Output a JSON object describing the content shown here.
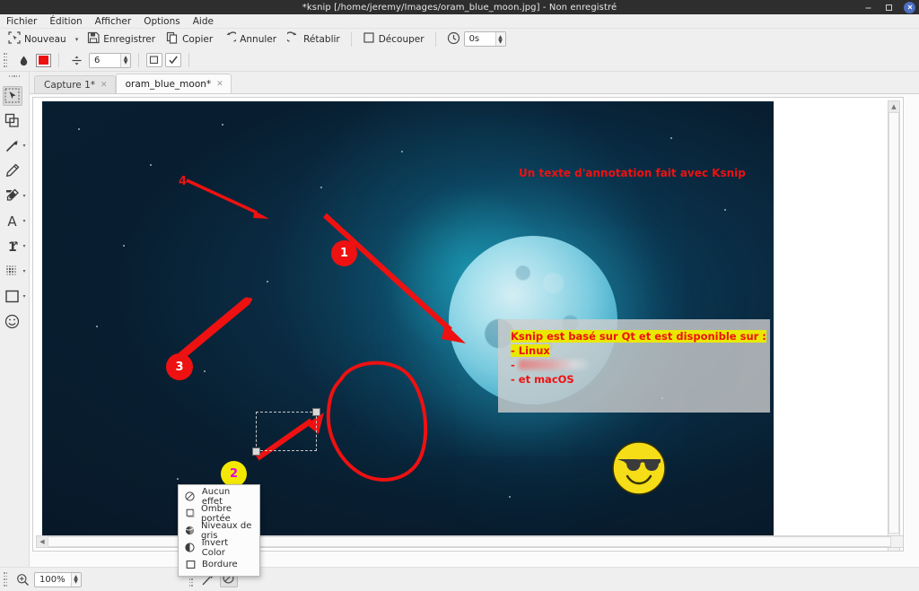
{
  "window": {
    "title": "*ksnip [/home/jeremy/Images/oram_blue_moon.jpg] - Non enregistré",
    "minimize_label": "—",
    "maximize_label": "❐",
    "close_label": "✕"
  },
  "menubar": {
    "items": [
      {
        "label": "Fichier",
        "accel": "F"
      },
      {
        "label": "Édition",
        "accel": "d"
      },
      {
        "label": "Afficher",
        "accel": "A"
      },
      {
        "label": "Options",
        "accel": "O"
      },
      {
        "label": "Aide",
        "accel": "A"
      }
    ]
  },
  "toolbar": {
    "new_label": "Nouveau",
    "new_icon": "new-capture-icon",
    "save_label": "Enregistrer",
    "save_icon": "floppy-disk-icon",
    "copy_label": "Copier",
    "copy_icon": "copy-icon",
    "undo_label": "Annuler",
    "undo_icon": "undo-arrow-icon",
    "redo_label": "Rétablir",
    "redo_icon": "redo-arrow-icon",
    "crop_label": "Découper",
    "crop_icon": "crop-square-icon",
    "delay_icon": "clock-icon",
    "delay_value": "0s"
  },
  "toolbar_props": {
    "opacity_icon": "water-drop-icon",
    "color_label": "",
    "color_hex": "#ee1111",
    "width_icon": "line-width-icon",
    "width_value": "6",
    "fill_icon": "fill-square-icon",
    "check_icon": "checkbox-checked-icon"
  },
  "tools": [
    {
      "name": "select-tool",
      "icon": "select-rectangle-icon",
      "active": true,
      "has_menu": false
    },
    {
      "name": "duplicate-tool",
      "icon": "duplicate-squares-icon",
      "active": false,
      "has_menu": false
    },
    {
      "name": "arrow-tool",
      "icon": "arrow-icon",
      "active": false,
      "has_menu": true
    },
    {
      "name": "pen-tool",
      "icon": "pencil-icon",
      "active": false,
      "has_menu": false
    },
    {
      "name": "marker-tool",
      "icon": "marker-pen-icon",
      "active": false,
      "has_menu": true
    },
    {
      "name": "text-tool",
      "icon": "text-a-icon",
      "active": false,
      "has_menu": true
    },
    {
      "name": "number-tool",
      "icon": "number-one-icon",
      "active": false,
      "has_menu": true
    },
    {
      "name": "blur-tool",
      "icon": "blur-dots-icon",
      "active": false,
      "has_menu": true
    },
    {
      "name": "rectangle-tool",
      "icon": "rectangle-icon",
      "active": false,
      "has_menu": true
    },
    {
      "name": "emoji-tool",
      "icon": "smiley-face-icon",
      "active": false,
      "has_menu": false
    }
  ],
  "tabs": [
    {
      "label": "Capture 1*",
      "active": false
    },
    {
      "label": "oram_blue_moon*",
      "active": true
    }
  ],
  "annotations": {
    "title_text": "Un texte d'annotation fait avec Ksnip",
    "title_color": "#ee1111",
    "badges": [
      {
        "label": "1",
        "style": "red"
      },
      {
        "label": "2",
        "style": "yellow"
      },
      {
        "label": "3",
        "style": "red"
      },
      {
        "label": "4",
        "style": "none"
      }
    ],
    "textbox": {
      "line1": "Ksnip est basé sur Qt et est disponible sur :",
      "line2": "- Linux",
      "line3_prefix": "- ",
      "line3_blurred": true,
      "line4": "- et macOS",
      "highlight_color": "#e9e800",
      "text_color": "#ee1111"
    },
    "emoji": "sunglasses-smiley"
  },
  "context_menu": {
    "items": [
      {
        "label": "Aucun effet",
        "icon": "no-effect-icon"
      },
      {
        "label": "Ombre portée",
        "icon": "drop-shadow-icon"
      },
      {
        "label": "Niveaux de gris",
        "icon": "grayscale-icon"
      },
      {
        "label": "Invert Color",
        "icon": "invert-color-icon"
      },
      {
        "label": "Bordure",
        "icon": "border-icon"
      }
    ]
  },
  "statusbar": {
    "zoom_icon": "magnifier-icon",
    "zoom_value": "100%",
    "wand_icon": "magic-wand-icon",
    "effect_icon": "no-effect-icon"
  },
  "scrollbars": {
    "v_up": "▲",
    "v_down": "▼",
    "h_left": "◀",
    "h_right": "▶"
  }
}
